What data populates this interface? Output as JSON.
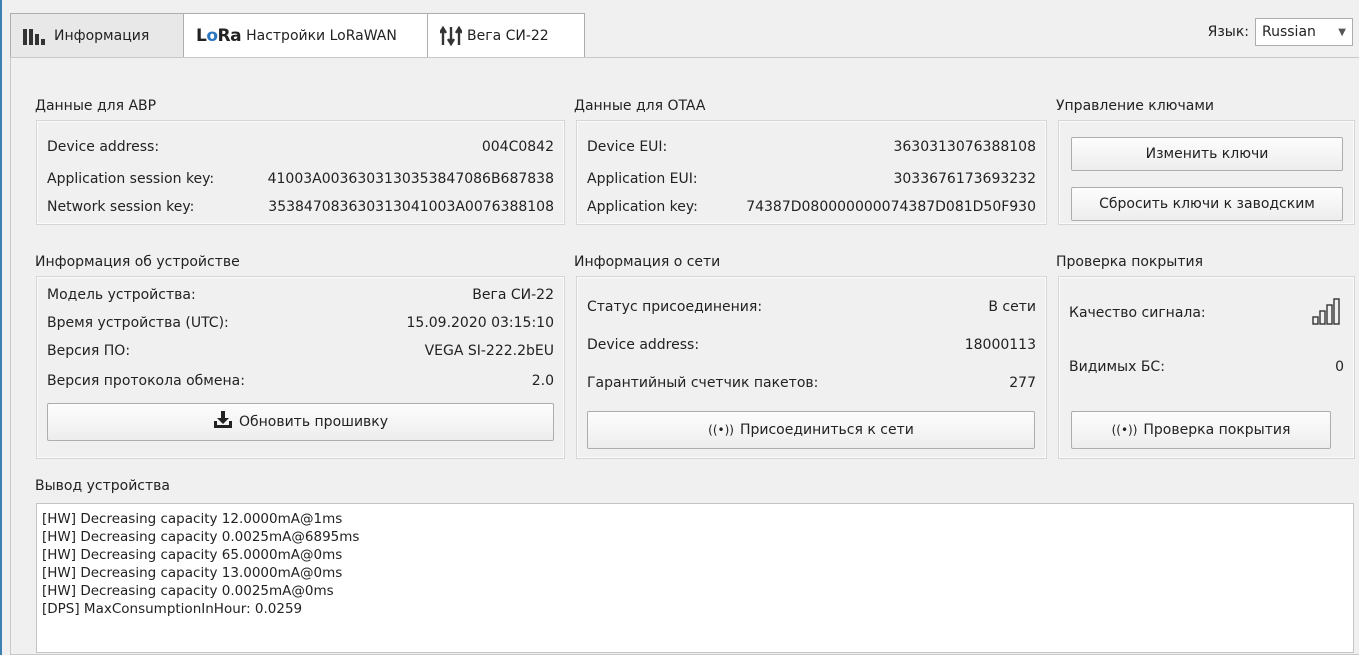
{
  "tabs": [
    {
      "label": "Информация",
      "icon": "bar-chart-icon",
      "active": true
    },
    {
      "label": "Настройки LoRaWAN",
      "icon": "lora-logo-icon",
      "icon_text": "LoRa",
      "active": false
    },
    {
      "label": "Вега СИ-22",
      "icon": "arrows-updown-icon",
      "active": false
    }
  ],
  "language": {
    "label": "Язык:",
    "value": "Russian"
  },
  "abp": {
    "title": "Данные для ABP",
    "rows": [
      {
        "label": "Device address:",
        "value": "004C0842"
      },
      {
        "label": "Application session key:",
        "value": "41003A0036303130353847086B687838"
      },
      {
        "label": "Network session key:",
        "value": "35384708363031304100 3A0076388108"
      }
    ]
  },
  "otaa": {
    "title": "Данные для OTAA",
    "rows": [
      {
        "label": "Device EUI:",
        "value": "3630313076388108"
      },
      {
        "label": "Application EUI:",
        "value": "3033676173693232"
      },
      {
        "label": "Application key:",
        "value": "74387D080000000074387D081D50F930"
      }
    ]
  },
  "keys": {
    "title": "Управление ключами",
    "change_button": "Изменить ключи",
    "reset_button": "Сбросить ключи к заводским"
  },
  "device_info": {
    "title": "Информация об устройстве",
    "rows": [
      {
        "label": "Модель устройства:",
        "value": "Вега СИ-22"
      },
      {
        "label": "Время устройства (UTC):",
        "value": "15.09.2020 03:15:10"
      },
      {
        "label": "Версия ПО:",
        "value": "VEGA SI-222.2bEU"
      },
      {
        "label": "Версия протокола обмена:",
        "value": "2.0"
      }
    ],
    "update_button": "Обновить прошивку"
  },
  "network": {
    "title": "Информация о сети",
    "rows": [
      {
        "label": "Статус присоединения:",
        "value": "В сети"
      },
      {
        "label": "Device address:",
        "value": "18000113"
      },
      {
        "label": "Гарантийный счетчик пакетов:",
        "value": "277"
      }
    ],
    "join_button": "Присоединиться к сети"
  },
  "coverage": {
    "title": "Проверка покрытия",
    "signal_label": "Качество сигнала:",
    "signal_level": 0,
    "bs_label": "Видимых БС:",
    "bs_value": "0",
    "check_button": "Проверка покрытия"
  },
  "output": {
    "title": "Вывод устройства",
    "lines": [
      "[HW] Decreasing capacity 12.0000mA@1ms",
      "[HW] Decreasing capacity 0.0025mA@6895ms",
      "[HW] Decreasing capacity 65.0000mA@0ms",
      "[HW] Decreasing capacity 13.0000mA@0ms",
      "[HW] Decreasing capacity 0.0025mA@0ms",
      "[DPS] MaxConsumptionInHour: 0.0259"
    ]
  },
  "colors": {
    "accent": "#2b76c0",
    "window_border": "#3c7fb1"
  }
}
